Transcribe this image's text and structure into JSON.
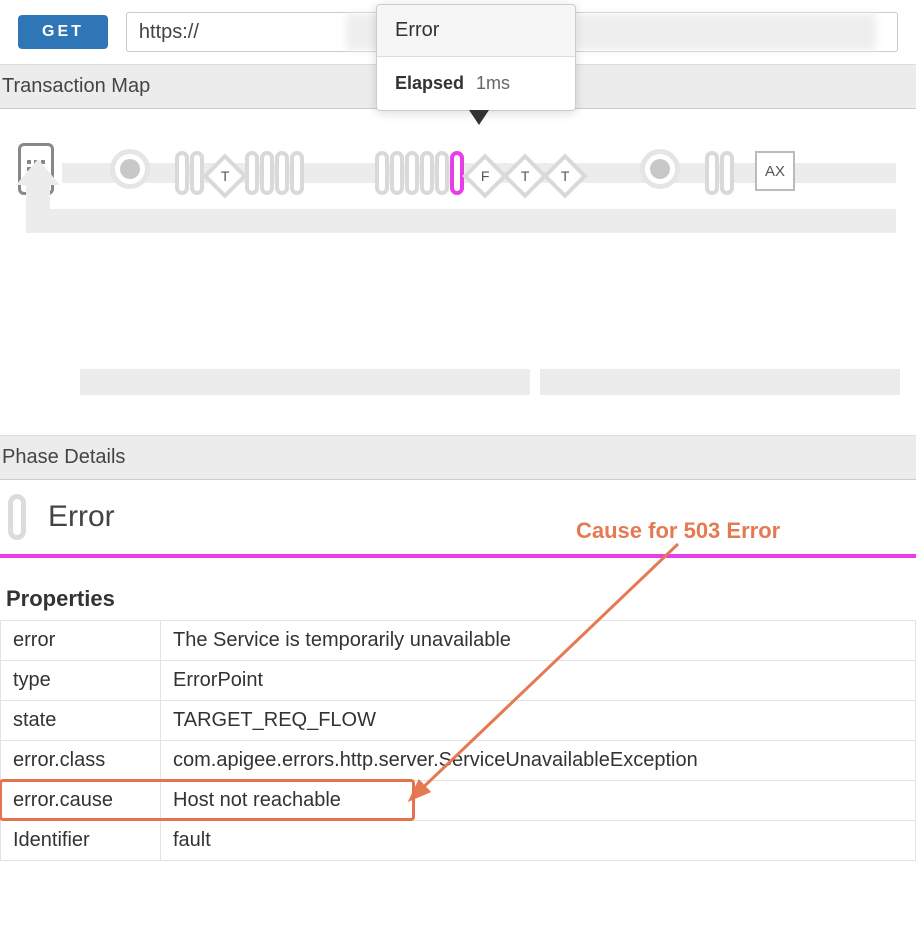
{
  "request": {
    "method": "GET",
    "url": "https://                            3                              /"
  },
  "tooltip": {
    "title": "Error",
    "elapsed_label": "Elapsed",
    "elapsed_value": "1ms"
  },
  "sections": {
    "transaction_map": "Transaction Map",
    "phase_details": "Phase Details"
  },
  "map": {
    "diamonds": [
      "T",
      "F",
      "T",
      "T"
    ],
    "end_box": "AX"
  },
  "phase": {
    "title": "Error"
  },
  "properties": {
    "title": "Properties",
    "rows": [
      {
        "k": "error",
        "v": "The Service is temporarily unavailable"
      },
      {
        "k": "type",
        "v": "ErrorPoint"
      },
      {
        "k": "state",
        "v": "TARGET_REQ_FLOW"
      },
      {
        "k": "error.class",
        "v": "com.apigee.errors.http.server.ServiceUnavailableException"
      },
      {
        "k": "error.cause",
        "v": "Host not reachable"
      },
      {
        "k": "Identifier",
        "v": "fault"
      }
    ]
  },
  "annotation": {
    "label": "Cause for 503 Error"
  }
}
